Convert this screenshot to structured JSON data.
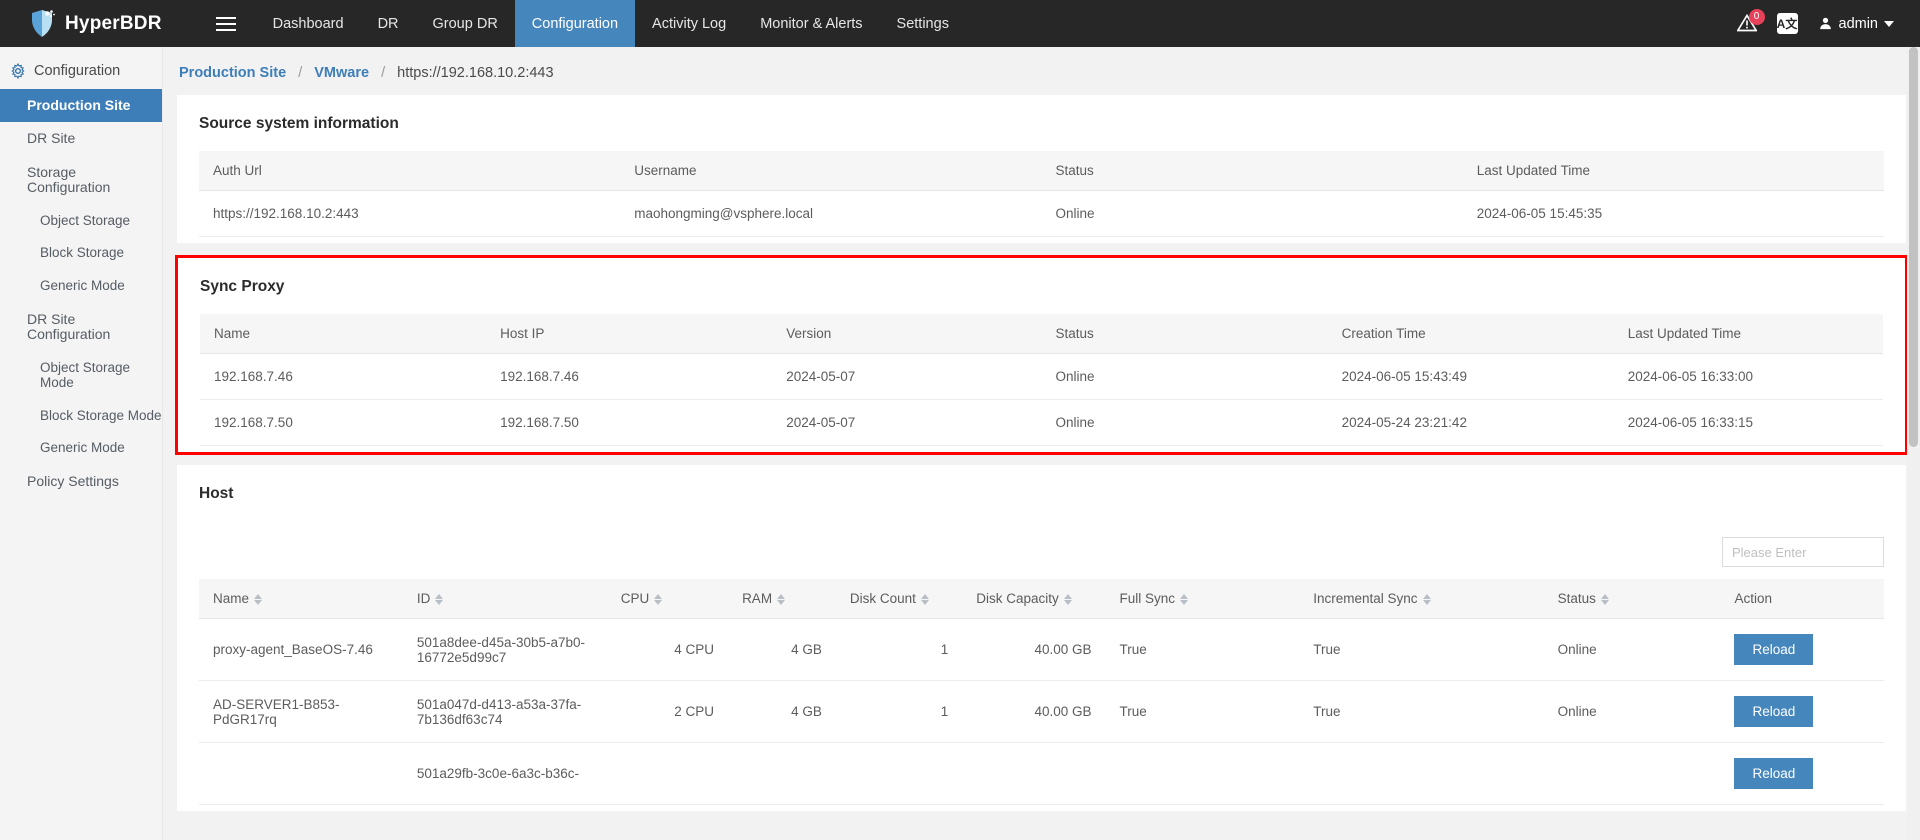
{
  "topnav": {
    "brand": "HyperBDR",
    "menu_icon": "hamburger-icon",
    "items": [
      {
        "label": "Dashboard",
        "active": false
      },
      {
        "label": "DR",
        "active": false
      },
      {
        "label": "Group DR",
        "active": false
      },
      {
        "label": "Configuration",
        "active": true
      },
      {
        "label": "Activity Log",
        "active": false
      },
      {
        "label": "Monitor & Alerts",
        "active": false
      },
      {
        "label": "Settings",
        "active": false
      }
    ],
    "alert_badge": "0",
    "lang_label": "A文",
    "user": "admin",
    "accent": "#4586bd",
    "background": "#272727",
    "badge_color": "#e8415a"
  },
  "sidebar": {
    "title": "Configuration",
    "items": [
      {
        "label": "Production Site",
        "active": true,
        "sub": false
      },
      {
        "label": "DR Site",
        "active": false,
        "sub": false
      },
      {
        "label": "Storage Configuration",
        "active": false,
        "sub": false
      },
      {
        "label": "Object Storage",
        "active": false,
        "sub": true
      },
      {
        "label": "Block Storage",
        "active": false,
        "sub": true
      },
      {
        "label": "Generic Mode",
        "active": false,
        "sub": true
      },
      {
        "label": "DR Site Configuration",
        "active": false,
        "sub": false
      },
      {
        "label": "Object Storage Mode",
        "active": false,
        "sub": true
      },
      {
        "label": "Block Storage Mode",
        "active": false,
        "sub": true
      },
      {
        "label": "Generic Mode",
        "active": false,
        "sub": true
      },
      {
        "label": "Policy Settings",
        "active": false,
        "sub": false
      }
    ]
  },
  "breadcrumb": {
    "first": "Production Site",
    "second": "VMware",
    "current": "https://192.168.10.2:443",
    "separator": "/"
  },
  "source_system": {
    "title": "Source system information",
    "columns": [
      "Auth Url",
      "Username",
      "Status",
      "Last Updated Time"
    ],
    "rows": [
      [
        "https://192.168.10.2:443",
        "maohongming@vsphere.local",
        "Online",
        "2024-06-05 15:45:35"
      ]
    ]
  },
  "sync_proxy": {
    "title": "Sync Proxy",
    "highlight_color": "#ff0000",
    "columns": [
      "Name",
      "Host IP",
      "Version",
      "Status",
      "Creation Time",
      "Last Updated Time"
    ],
    "rows": [
      [
        "192.168.7.46",
        "192.168.7.46",
        "2024-05-07",
        "Online",
        "2024-06-05 15:43:49",
        "2024-06-05 16:33:00"
      ],
      [
        "192.168.7.50",
        "192.168.7.50",
        "2024-05-07",
        "Online",
        "2024-05-24 23:21:42",
        "2024-06-05 16:33:15"
      ]
    ]
  },
  "host": {
    "title": "Host",
    "search_placeholder": "Please Enter",
    "search_value": "",
    "columns": [
      {
        "label": "Name",
        "sortable": true
      },
      {
        "label": "ID",
        "sortable": true
      },
      {
        "label": "CPU",
        "sortable": true
      },
      {
        "label": "RAM",
        "sortable": true
      },
      {
        "label": "Disk Count",
        "sortable": true
      },
      {
        "label": "Disk Capacity",
        "sortable": true
      },
      {
        "label": "Full Sync",
        "sortable": true
      },
      {
        "label": "Incremental Sync",
        "sortable": true
      },
      {
        "label": "Status",
        "sortable": true
      },
      {
        "label": "Action",
        "sortable": false
      }
    ],
    "action_label": "Reload",
    "rows": [
      {
        "name": "proxy-agent_BaseOS-7.46",
        "id": "501a8dee-d45a-30b5-a7b0-16772e5d99c7",
        "cpu": "4 CPU",
        "ram": "4 GB",
        "disk_count": "1",
        "disk_capacity": "40.00 GB",
        "full_sync": "True",
        "incremental_sync": "True",
        "status": "Online"
      },
      {
        "name": "AD-SERVER1-B853-PdGR17rq",
        "id": "501a047d-d413-a53a-37fa-7b136df63c74",
        "cpu": "2 CPU",
        "ram": "4 GB",
        "disk_count": "1",
        "disk_capacity": "40.00 GB",
        "full_sync": "True",
        "incremental_sync": "True",
        "status": "Online"
      },
      {
        "name": "",
        "id": "501a29fb-3c0e-6a3c-b36c-",
        "cpu": "",
        "ram": "",
        "disk_count": "",
        "disk_capacity": "",
        "full_sync": "",
        "incremental_sync": "",
        "status": ""
      }
    ]
  }
}
